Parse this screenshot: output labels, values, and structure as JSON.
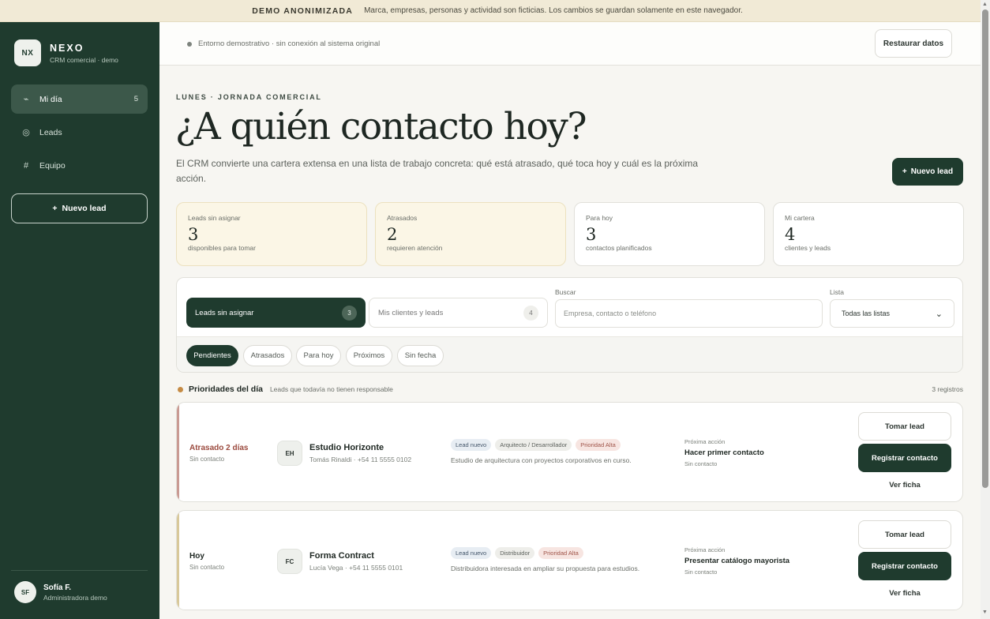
{
  "banner": {
    "tag": "DEMO ANONIMIZADA",
    "text": "Marca, empresas, personas y actividad son ficticias. Los cambios se guardan solamente en este navegador."
  },
  "sidebar": {
    "logo": "NX",
    "brand_name": "NEXO",
    "brand_sub": "CRM comercial · demo",
    "items": [
      {
        "label": "Mi día",
        "icon": "sun-horizon-icon",
        "count": "5",
        "active": true
      },
      {
        "label": "Leads",
        "icon": "target-icon",
        "count": ""
      },
      {
        "label": "Equipo",
        "icon": "grid-icon",
        "count": ""
      }
    ],
    "new_lead": "Nuevo lead",
    "user": {
      "initials": "SF",
      "name": "Sofía F.",
      "role": "Administradora demo"
    }
  },
  "topbar": {
    "env": "Entorno demostrativo · sin conexión al sistema original",
    "restore": "Restaurar datos"
  },
  "header": {
    "eyebrow": "LUNES · JORNADA COMERCIAL",
    "title": "¿A quién contacto hoy?",
    "intro": "El CRM convierte una cartera extensa en una lista de trabajo concreta: qué está atrasado, qué toca hoy y cuál es la próxima acción.",
    "new_lead": "Nuevo lead"
  },
  "stats": [
    {
      "label": "Leads sin asignar",
      "value": "3",
      "sub": "disponibles para tomar"
    },
    {
      "label": "Atrasados",
      "value": "2",
      "sub": "requieren atención"
    },
    {
      "label": "Para hoy",
      "value": "3",
      "sub": "contactos planificados"
    },
    {
      "label": "Mi cartera",
      "value": "4",
      "sub": "clientes y leads"
    }
  ],
  "filters": {
    "segments": [
      {
        "label": "Leads sin asignar",
        "count": "3"
      },
      {
        "label": "Mis clientes y leads",
        "count": "4"
      }
    ],
    "search_label": "Buscar",
    "search_placeholder": "Empresa, contacto o teléfono",
    "list_label": "Lista",
    "list_value": "Todas las listas",
    "chips": [
      "Pendientes",
      "Atrasados",
      "Para hoy",
      "Próximos",
      "Sin fecha"
    ]
  },
  "priorities": {
    "title": "Prioridades del día",
    "subtitle": "Leads que todavía no tienen responsable",
    "count": "3 registros"
  },
  "leads": [
    {
      "status": "Atrasado 2 días",
      "status_color": "#9b4a3e",
      "edge_color": "#c99a93",
      "status_sub": "Sin contacto",
      "initials": "EH",
      "name": "Estudio Horizonte",
      "contact": "Tomás Rinaldi · +54 11 5555 0102",
      "tags": [
        "Lead nuevo",
        "Arquitecto / Desarrollador",
        "Prioridad Alta"
      ],
      "description": "Estudio de arquitectura con proyectos corporativos en curso.",
      "next_label": "Próxima acción",
      "next_action": "Hacer primer contacto",
      "next_sub": "Sin contacto",
      "take": "Tomar lead",
      "register": "Registrar contacto",
      "view": "Ver ficha"
    },
    {
      "status": "Hoy",
      "status_color": "#1e2722",
      "edge_color": "#d8c89a",
      "status_sub": "Sin contacto",
      "initials": "FC",
      "name": "Forma Contract",
      "contact": "Lucía Vega · +54 11 5555 0101",
      "tags": [
        "Lead nuevo",
        "Distribuidor",
        "Prioridad Alta"
      ],
      "description": "Distribuidora interesada en ampliar su propuesta para estudios.",
      "next_label": "Próxima acción",
      "next_action": "Presentar catálogo mayorista",
      "next_sub": "Sin contacto",
      "take": "Tomar lead",
      "register": "Registrar contacto",
      "view": "Ver ficha"
    }
  ]
}
